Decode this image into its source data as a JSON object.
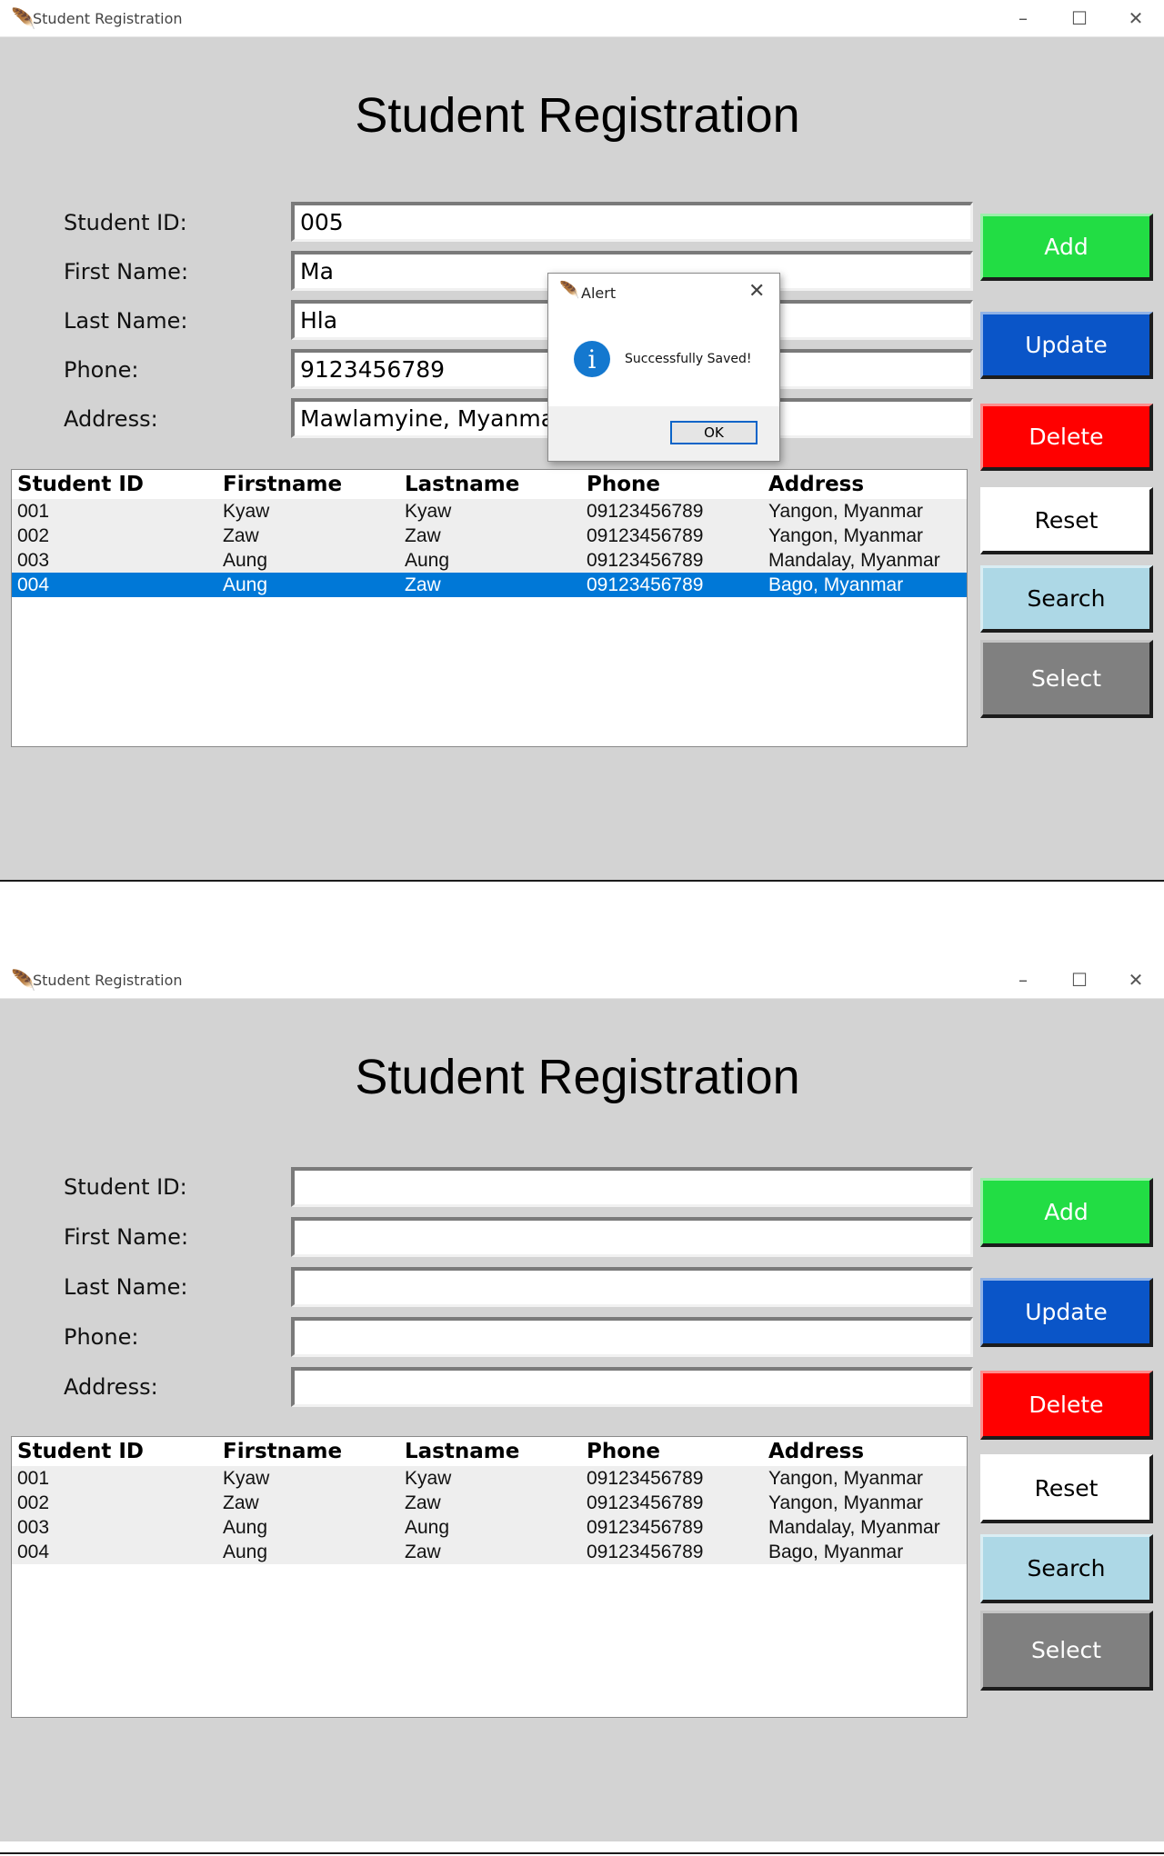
{
  "window": {
    "title": "Student Registration",
    "controls": {
      "minimize": "–",
      "maximize": "☐",
      "close": "✕"
    }
  },
  "heading": "Student Registration",
  "labels": {
    "student_id": "Student ID:",
    "first_name": "First Name:",
    "last_name": "Last Name:",
    "phone": "Phone:",
    "address": "Address:"
  },
  "buttons": {
    "add": "Add",
    "update": "Update",
    "delete": "Delete",
    "reset": "Reset",
    "search": "Search",
    "select": "Select"
  },
  "colors": {
    "add": "#22dd44",
    "update": "#0a55c8",
    "delete": "#ff0000",
    "reset": "#ffffff",
    "search": "#add8e6",
    "select": "#808080"
  },
  "table": {
    "headers": [
      "Student ID",
      "Firstname",
      "Lastname",
      "Phone",
      "Address"
    ],
    "rows": [
      [
        "001",
        "Kyaw",
        "Kyaw",
        "09123456789",
        "Yangon,  Myanmar"
      ],
      [
        "002",
        "Zaw",
        "Zaw",
        "09123456789",
        "Yangon,  Myanmar"
      ],
      [
        "003",
        "Aung",
        "Aung",
        "09123456789",
        "Mandalay,  Myanmar"
      ],
      [
        "004",
        "Aung",
        "Zaw",
        "09123456789",
        "Bago,  Myanmar"
      ]
    ]
  },
  "screen1": {
    "fields": {
      "student_id": "005",
      "first_name": "Ma",
      "last_name": "Hla",
      "phone": "9123456789",
      "address": "Mawlamyine,  Myanmar"
    },
    "selected_row": "004",
    "dialog": {
      "title": "Alert",
      "message": "Successfully Saved!",
      "ok": "OK",
      "icon": "info-icon",
      "close": "✕"
    }
  },
  "screen2": {
    "fields": {
      "student_id": "",
      "first_name": "",
      "last_name": "",
      "phone": "",
      "address": ""
    }
  }
}
